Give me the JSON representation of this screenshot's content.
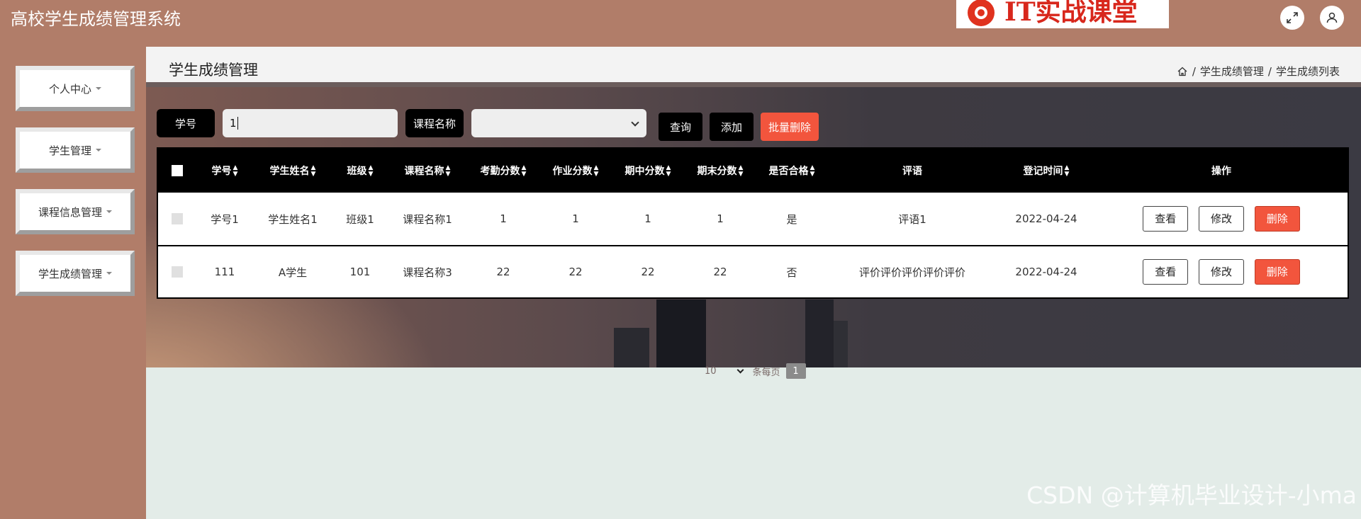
{
  "app": {
    "title": "高校学生成绩管理系统"
  },
  "brand": {
    "text": "IT实战课堂"
  },
  "sidebar": {
    "items": [
      {
        "label": "个人中心"
      },
      {
        "label": "学生管理"
      },
      {
        "label": "课程信息管理"
      },
      {
        "label": "学生成绩管理"
      }
    ]
  },
  "page": {
    "title": "学生成绩管理",
    "breadcrumb": [
      "学生成绩管理",
      "学生成绩列表"
    ]
  },
  "search": {
    "student_id_label": "学号",
    "student_id_value": "1",
    "course_label": "课程名称",
    "course_selected": "",
    "query_button": "查询",
    "add_button": "添加",
    "batch_delete_button": "批量删除"
  },
  "table": {
    "columns": [
      "学号",
      "学生姓名",
      "班级",
      "课程名称",
      "考勤分数",
      "作业分数",
      "期中分数",
      "期末分数",
      "是否合格",
      "评语",
      "登记时间",
      "操作"
    ],
    "rows": [
      [
        "学号1",
        "学生姓名1",
        "班级1",
        "课程名称1",
        "1",
        "1",
        "1",
        "1",
        "是",
        "评语1",
        "2022-04-24"
      ],
      [
        "111",
        "A学生",
        "101",
        "课程名称3",
        "22",
        "22",
        "22",
        "22",
        "否",
        "评价评价评价评价评价",
        "2022-04-24"
      ]
    ],
    "actions": {
      "view": "查看",
      "edit": "修改",
      "delete": "删除"
    }
  },
  "pager": {
    "page_size": "10",
    "total_text": "条每页",
    "current_page": "1"
  },
  "watermark": "CSDN @计算机毕业设计-小ma"
}
